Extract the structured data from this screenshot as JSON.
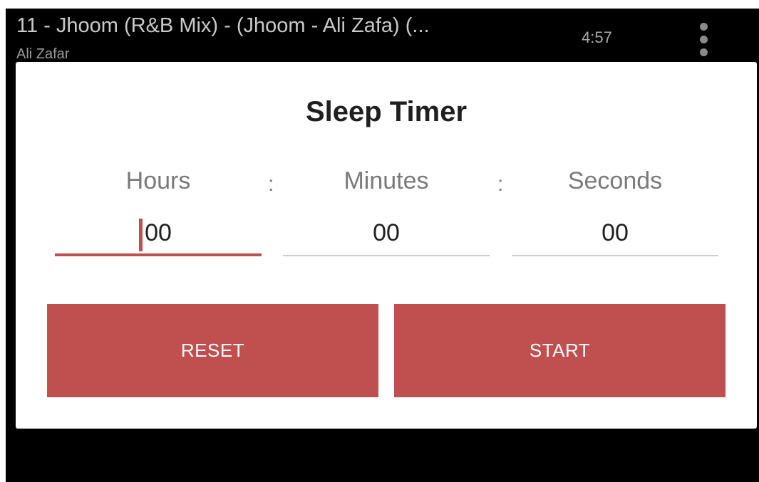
{
  "now_playing": {
    "title": "11 - Jhoom (R&B Mix) -  (Jhoom - Ali Zafa) (...",
    "artist": "Ali Zafar",
    "duration": "4:57",
    "menu_icon": "more-vertical-icon"
  },
  "dialog": {
    "title": "Sleep Timer",
    "separator": ":",
    "fields": [
      {
        "label": "Hours",
        "value": "00",
        "active": true
      },
      {
        "label": "Minutes",
        "value": "00",
        "active": false
      },
      {
        "label": "Seconds",
        "value": "00",
        "active": false
      }
    ],
    "reset_label": "RESET",
    "start_label": "START"
  },
  "colors": {
    "accent": "#c0504f",
    "background": "#000000",
    "dialog_background": "#ffffff",
    "label": "#7a7a7a",
    "text": "#1f1f1f"
  }
}
